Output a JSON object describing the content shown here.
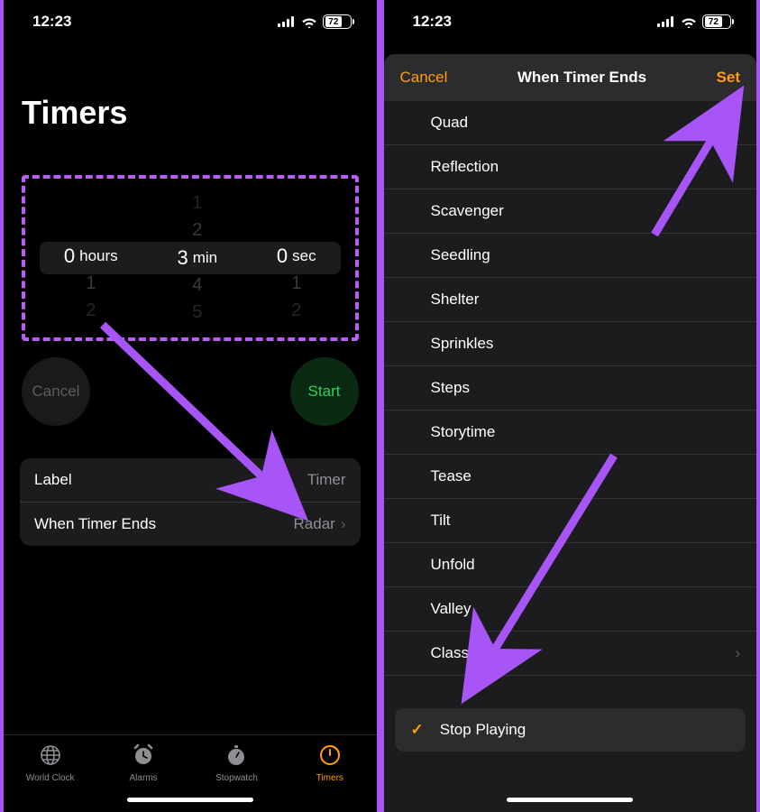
{
  "status": {
    "time": "12:23",
    "battery": "72"
  },
  "screen1": {
    "title": "Timers",
    "picker": {
      "hours": {
        "above2": "",
        "above1": "",
        "selected": "0",
        "below1": "1",
        "below2": "2",
        "unit": "hours"
      },
      "minutes": {
        "above2": "1",
        "above1": "2",
        "selected": "3",
        "below1": "4",
        "below2": "5",
        "unit": "min"
      },
      "seconds": {
        "above2": "",
        "above1": "",
        "selected": "0",
        "below1": "1",
        "below2": "2",
        "unit": "sec"
      }
    },
    "cancel": "Cancel",
    "start": "Start",
    "rows": {
      "label": {
        "title": "Label",
        "value": "Timer"
      },
      "whenEnds": {
        "title": "When Timer Ends",
        "value": "Radar"
      }
    },
    "tabs": {
      "worldClock": "World Clock",
      "alarms": "Alarms",
      "stopwatch": "Stopwatch",
      "timers": "Timers"
    }
  },
  "screen2": {
    "cancel": "Cancel",
    "title": "When Timer Ends",
    "set": "Set",
    "sounds": [
      "Quad",
      "Reflection",
      "Scavenger",
      "Seedling",
      "Shelter",
      "Sprinkles",
      "Steps",
      "Storytime",
      "Tease",
      "Tilt",
      "Unfold",
      "Valley",
      "Classic"
    ],
    "stopPlaying": "Stop Playing"
  }
}
